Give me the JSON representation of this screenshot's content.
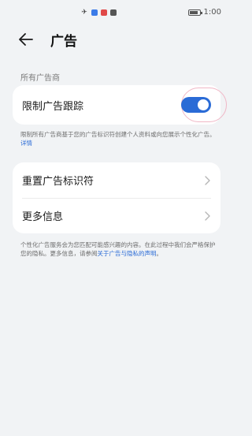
{
  "status_bar": {
    "time": "1:00",
    "icons": [
      "airplane-icon",
      "blue-app-icon",
      "red-app-icon",
      "dark-app-icon"
    ]
  },
  "header": {
    "title": "广告"
  },
  "section": {
    "label": "所有广告商"
  },
  "limit_tracking": {
    "label": "限制广告跟踪",
    "toggle_on": true,
    "toggle_color": "#2a6bd6"
  },
  "limit_tracking_desc": {
    "text": "限制所有广告商基于您的广告标识符创建个人资料或向您展示个性化广告。",
    "link": "详情"
  },
  "menu": {
    "items": [
      {
        "label": "重置广告标识符"
      },
      {
        "label": "更多信息"
      }
    ]
  },
  "footer_desc": {
    "text": "个性化广告服务会为您匹配可能感兴趣的内容。在此过程中我们会严格保护您的隐私。更多信息，请参阅",
    "link": "关于广告与隐私的声明",
    "end": "。"
  },
  "colors": {
    "accent": "#2a6bd6",
    "background": "#f1f3f5",
    "card": "#ffffff"
  }
}
